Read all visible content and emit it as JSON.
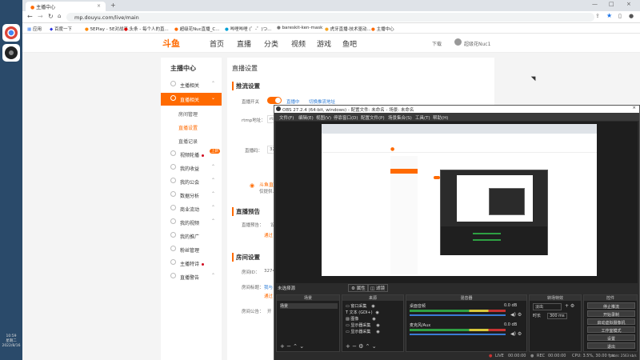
{
  "taskbar": {
    "clock_time": "10:59",
    "clock_weekday": "星期二",
    "clock_date": "2022/8/16"
  },
  "browser": {
    "tab_title": "主播中心",
    "url": "mp.douyu.com/live/main",
    "bookmarks": [
      "应用",
      "百度一下",
      "5EPlay - 5E对战平...",
      "头条 - 每个人的直...",
      "超级花Nuc直播_C...",
      "哔哩哔哩 (゜-゜)つ...",
      "bareskit-ken-mask",
      "虎牙直播-技术驱动...",
      "主播中心"
    ]
  },
  "site": {
    "logo": "斗鱼",
    "nav": [
      "首页",
      "直播",
      "分类",
      "视频",
      "游戏",
      "鱼吧"
    ],
    "header_right": [
      "下载",
      "超级花Nuc1"
    ]
  },
  "sidebar": {
    "title": "主播中心",
    "items": [
      {
        "label": "主播相关"
      },
      {
        "label": "直播相关"
      },
      {
        "label": "房间管理"
      },
      {
        "label": "直播设置"
      },
      {
        "label": "直播记录"
      },
      {
        "label": "视频轮播"
      },
      {
        "label": "我的收益"
      },
      {
        "label": "我的公会"
      },
      {
        "label": "数据分析"
      },
      {
        "label": "商业流动"
      },
      {
        "label": "我的视频"
      },
      {
        "label": "我的推广"
      },
      {
        "label": "粉丝管理"
      },
      {
        "label": "主播特诗"
      },
      {
        "label": "直播警告"
      }
    ],
    "badge": "上新"
  },
  "main": {
    "title": "直播设置",
    "section1": "推流设置",
    "push_switch_label": "直播开关",
    "links": [
      "直播中",
      "切换推流地址"
    ],
    "rtmp_label": "rtmp地址：",
    "rtmp_value": "rtmp",
    "code_label": "直播码：",
    "code_value": "3274",
    "tip1": "斗鱼直",
    "tip2": "仅提供上",
    "section2": "直播预告",
    "notice_label": "直播预告：",
    "notice_value": "设",
    "notice_link": "通过",
    "section3": "房间设置",
    "room_id_label": "房间ID：",
    "room_id_value": "3274",
    "room_title_label": "房间标题：",
    "room_title_value": "我与",
    "room_title_link": "通过",
    "room_notice_label": "房间公告：",
    "room_notice_value": "开"
  },
  "obs": {
    "title": "OBS 27.2.4 (64-bit, windows) - 配置文件: 未命名 - 场景: 未命名",
    "menu": [
      "文件(F)",
      "编辑(E)",
      "视图(V)",
      "停靠窗口(D)",
      "配置文件(P)",
      "场景集合(S)",
      "工具(T)",
      "帮助(H)"
    ],
    "scene_bar": "未选择源",
    "scene_buttons": [
      "属性",
      "滤镜"
    ],
    "docks": {
      "scenes": {
        "title": "场景",
        "items": [
          "场景"
        ]
      },
      "sources": {
        "title": "来源",
        "items": [
          "窗口采集",
          "文本 (GDI+)",
          "图像",
          "显示器采集",
          "显示器采集"
        ]
      },
      "mixer": {
        "title": "混音器",
        "channels": [
          {
            "name": "桌面音频",
            "db": "0.0 dB"
          },
          {
            "name": "麦克风/Aux",
            "db": "0.0 dB"
          }
        ]
      },
      "transitions": {
        "title": "转场特效",
        "type": "淡出",
        "duration_label": "时长",
        "duration": "300 ms"
      },
      "controls": {
        "title": "控件",
        "buttons": [
          "停止推流",
          "开始录制",
          "启动虚拟摄像机",
          "工作室模式",
          "设置",
          "退出"
        ]
      }
    },
    "status": {
      "live_label": "LIVE",
      "live_time": "00:00:00",
      "rec_label": "REC",
      "rec_time": "00:00:00",
      "cpu": "CPU: 3.5%, 30.00 fps",
      "kbps": "kb/s: 2563 kb/s"
    }
  },
  "colors": {
    "accent": "#ff6a00",
    "obs_bg": "#2b2b2b",
    "taskbar": "#2a4a6a"
  }
}
